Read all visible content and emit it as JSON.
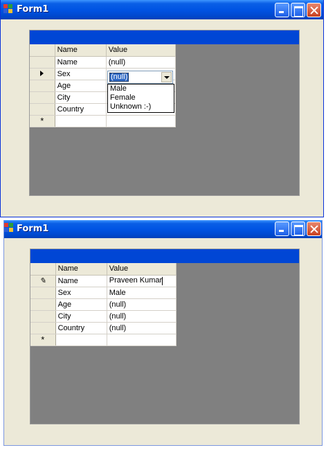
{
  "window1": {
    "title": "Form1",
    "grid": {
      "columns": [
        "Name",
        "Value"
      ],
      "rows": [
        {
          "name": "Name",
          "value": "(null)"
        },
        {
          "name": "Sex",
          "value": ""
        },
        {
          "name": "Age",
          "value": ""
        },
        {
          "name": "City",
          "value": ""
        },
        {
          "name": "Country",
          "value": ""
        }
      ],
      "current_row_marker": "arrow",
      "new_row_marker": "*"
    },
    "combo": {
      "selected": "(null)",
      "options": [
        "Male",
        "Female",
        "Unknown :-)"
      ]
    }
  },
  "window2": {
    "title": "Form1",
    "grid": {
      "columns": [
        "Name",
        "Value"
      ],
      "rows": [
        {
          "name": "Name",
          "value": "Praveen Kumar"
        },
        {
          "name": "Sex",
          "value": "Male"
        },
        {
          "name": "Age",
          "value": "(null)"
        },
        {
          "name": "City",
          "value": "(null)"
        },
        {
          "name": "Country",
          "value": "(null)"
        }
      ],
      "editing_row_marker": "pencil",
      "new_row_marker": "*"
    }
  },
  "colors": {
    "titlebar": "#0054e3",
    "grid_caption": "#0046d5",
    "grid_background": "#808080",
    "form_background": "#ece9d8"
  }
}
